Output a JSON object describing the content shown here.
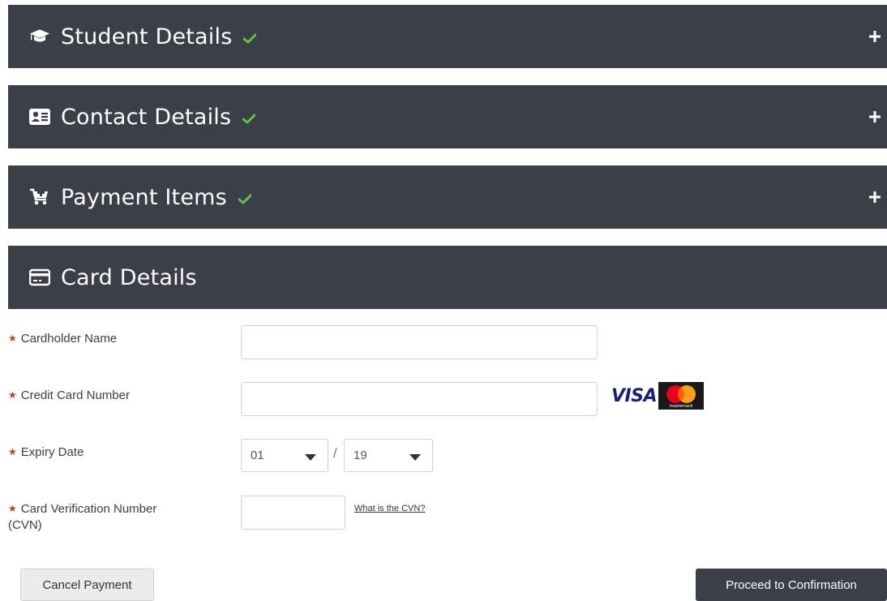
{
  "panels": {
    "student": {
      "title": "Student Details",
      "icon": "graduation-cap-icon",
      "completed": true
    },
    "contact": {
      "title": "Contact Details",
      "icon": "contact-card-icon",
      "completed": true
    },
    "payment": {
      "title": "Payment Items",
      "icon": "cart-icon",
      "completed": true
    },
    "card": {
      "title": "Card Details",
      "icon": "credit-card-icon",
      "completed": false
    }
  },
  "form": {
    "cardholder_label": "Cardholder Name",
    "cardholder_value": "",
    "card_number_label": "Credit Card Number",
    "card_number_value": "",
    "card_brands": {
      "visa": "VISA",
      "mastercard": "mastercard"
    },
    "expiry_label": "Expiry Date",
    "expiry_month": "01",
    "expiry_separator": "/",
    "expiry_year": "19",
    "cvn_label_line1": "Card Verification Number",
    "cvn_label_line2": "(CVN)",
    "cvn_value": "",
    "cvn_help_link": "What is the CVN?",
    "required_marker": "★"
  },
  "actions": {
    "cancel_label": "Cancel Payment",
    "proceed_label": "Proceed to Confirmation"
  },
  "colors": {
    "panel_bg": "#3b3f47",
    "check_green": "#6abf4b",
    "required_red": "#c0392b",
    "visa_blue": "#1a1f71",
    "mc_red": "#eb001b",
    "mc_orange": "#f79e1b"
  }
}
